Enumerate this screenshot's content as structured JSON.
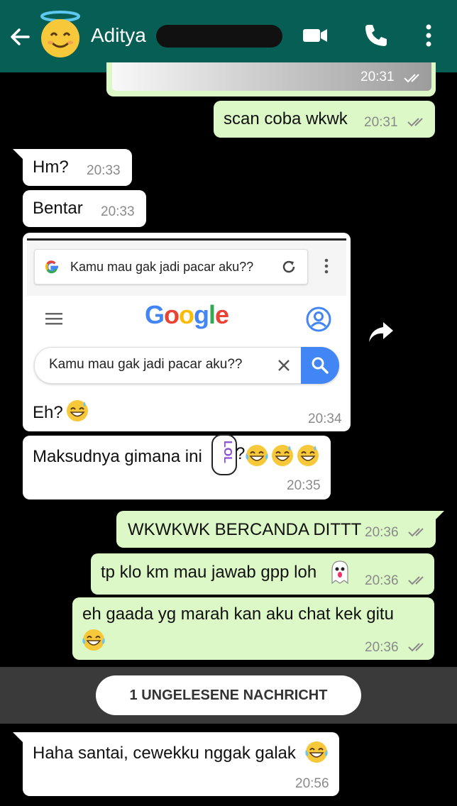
{
  "header": {
    "contact_name": "Aditya",
    "icons": [
      "back-arrow-icon",
      "smiling-face-with-halo-emoji",
      "video-call-icon",
      "phone-icon",
      "more-vertical-icon"
    ]
  },
  "messages": [
    {
      "text": "",
      "time": "20:31"
    },
    {
      "text": "scan coba wkwk",
      "time": "20:31"
    },
    {
      "text": "Hm?",
      "time": "20:33"
    },
    {
      "text": "Bentar",
      "time": "20:33"
    },
    {
      "text": "Eh?",
      "time": "20:34"
    },
    {
      "text": "Maksudnya gimana ini",
      "time": "20:35"
    },
    {
      "text": "WKWKWK BERCANDA DITTT",
      "time": "20:36"
    },
    {
      "text": "tp klo km mau jawab gpp loh",
      "time": "20:36"
    },
    {
      "text": "eh gaada yg marah kan aku chat kek gitu",
      "time": "20:36"
    },
    {
      "text": "Haha santai, cewekku nggak galak",
      "time": "20:56"
    }
  ],
  "screenshot": {
    "url_text": "Kamu mau gak jadi pacar aku??",
    "logo": "Google",
    "search_text": "Kamu mau gak jadi pacar aku??"
  },
  "sticker_text": "LOL",
  "unread_label": "1 UNGELESENE NACHRICHT",
  "colors": {
    "header": "#075e54",
    "outgoing": "#dcf8c6",
    "incoming": "#ffffff",
    "background": "#000000"
  }
}
